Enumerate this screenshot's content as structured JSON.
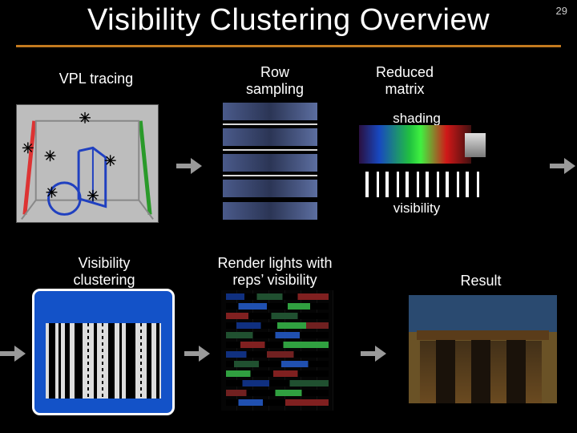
{
  "page_number": "29",
  "title": "Visibility Clustering Overview",
  "labels": {
    "vpl_tracing": "VPL tracing",
    "row_sampling": "Row\nsampling",
    "reduced_matrix": "Reduced\nmatrix",
    "shading": "shading",
    "visibility": "visibility",
    "visibility_clustering": "Visibility\nclustering",
    "render_lights": "Render lights with\nreps’ visibility",
    "result": "Result"
  }
}
